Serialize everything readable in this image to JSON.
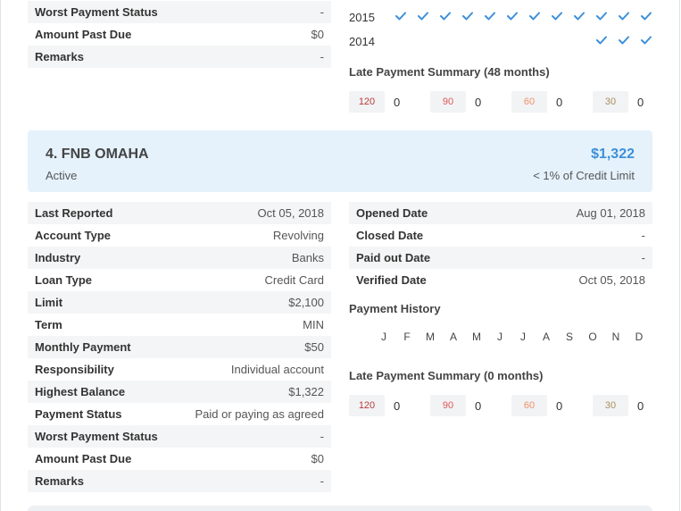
{
  "prev": {
    "rows": [
      {
        "label": "Worst Payment Status",
        "value": "-"
      },
      {
        "label": "Amount Past Due",
        "value": "$0"
      },
      {
        "label": "Remarks",
        "value": "-"
      }
    ],
    "history": {
      "year_2015": "2015",
      "year_2014": "2014",
      "checks_2015": 12,
      "checks_2014": 3
    },
    "late_title": "Late Payment Summary (48 months)",
    "late": [
      {
        "days": "120",
        "count": "0",
        "color": "#b63b3b"
      },
      {
        "days": "90",
        "count": "0",
        "color": "#e05757"
      },
      {
        "days": "60",
        "count": "0",
        "color": "#f0906a"
      },
      {
        "days": "30",
        "count": "0",
        "color": "#a89060"
      }
    ]
  },
  "account": {
    "name": "4. FNB OMAHA",
    "status": "Active",
    "balance": "$1,322",
    "utilization": "< 1% of Credit Limit",
    "accent": "#3d8fd9",
    "left_rows": [
      {
        "label": "Last Reported",
        "value": "Oct 05, 2018"
      },
      {
        "label": "Account Type",
        "value": "Revolving"
      },
      {
        "label": "Industry",
        "value": "Banks"
      },
      {
        "label": "Loan Type",
        "value": "Credit Card"
      },
      {
        "label": "Limit",
        "value": "$2,100"
      },
      {
        "label": "Term",
        "value": "MIN"
      },
      {
        "label": "Monthly Payment",
        "value": "$50"
      },
      {
        "label": "Responsibility",
        "value": "Individual account"
      },
      {
        "label": "Highest Balance",
        "value": "$1,322"
      },
      {
        "label": "Payment Status",
        "value": "Paid or paying as agreed"
      },
      {
        "label": "Worst Payment Status",
        "value": "-"
      },
      {
        "label": "Amount Past Due",
        "value": "$0"
      },
      {
        "label": "Remarks",
        "value": "-"
      }
    ],
    "right_rows": [
      {
        "label": "Opened Date",
        "value": "Aug 01, 2018"
      },
      {
        "label": "Closed Date",
        "value": "-"
      },
      {
        "label": "Paid out Date",
        "value": "-"
      },
      {
        "label": "Verified Date",
        "value": "Oct 05, 2018"
      }
    ],
    "payment_history_title": "Payment History",
    "months": [
      "J",
      "F",
      "M",
      "A",
      "M",
      "J",
      "J",
      "A",
      "S",
      "O",
      "N",
      "D"
    ],
    "late_title": "Late Payment Summary (0 months)",
    "late": [
      {
        "days": "120",
        "count": "0",
        "color": "#b63b3b"
      },
      {
        "days": "90",
        "count": "0",
        "color": "#e05757"
      },
      {
        "days": "60",
        "count": "0",
        "color": "#f0906a"
      },
      {
        "days": "30",
        "count": "0",
        "color": "#a89060"
      }
    ]
  }
}
